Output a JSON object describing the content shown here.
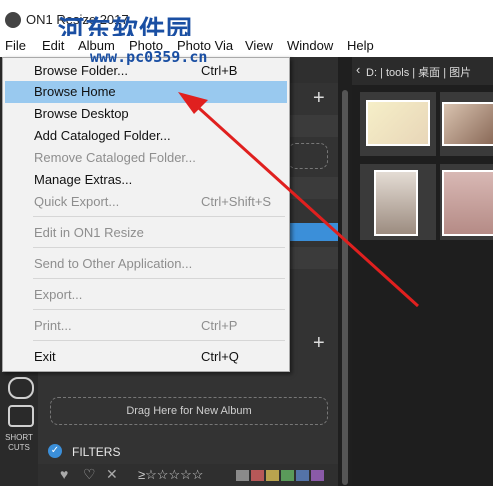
{
  "window": {
    "title": "ON1 Resize 2017"
  },
  "watermark": {
    "text": "河东软件园",
    "url": "www.pc0359.cn"
  },
  "menubar": {
    "items": [
      {
        "label": "File"
      },
      {
        "label": "Edit"
      },
      {
        "label": "Album"
      },
      {
        "label": "Photo"
      },
      {
        "label": "Photo Via"
      },
      {
        "label": "View"
      },
      {
        "label": "Window"
      },
      {
        "label": "Help"
      }
    ]
  },
  "file_menu": {
    "items": [
      {
        "label": "Browse Folder...",
        "shortcut": "Ctrl+B",
        "enabled": true
      },
      {
        "label": "Browse Home",
        "shortcut": "",
        "enabled": true,
        "highlighted": true
      },
      {
        "label": "Browse Desktop",
        "shortcut": "",
        "enabled": true
      },
      {
        "label": "Add Cataloged Folder...",
        "shortcut": "",
        "enabled": true
      },
      {
        "label": "Remove Cataloged Folder...",
        "shortcut": "",
        "enabled": false
      },
      {
        "label": "Manage Extras...",
        "shortcut": "",
        "enabled": true
      },
      {
        "label": "Quick Export...",
        "shortcut": "Ctrl+Shift+S",
        "enabled": false
      },
      {
        "label": "Edit in ON1 Resize",
        "shortcut": "",
        "enabled": false
      },
      {
        "label": "Send to Other Application...",
        "shortcut": "",
        "enabled": false
      },
      {
        "label": "Export...",
        "shortcut": "",
        "enabled": false
      },
      {
        "label": "Print...",
        "shortcut": "Ctrl+P",
        "enabled": false
      },
      {
        "label": "Exit",
        "shortcut": "Ctrl+Q",
        "enabled": true
      }
    ]
  },
  "path_bar": {
    "text": "D: | tools | 桌面 | 图片"
  },
  "albums": {
    "drag_label": "Drag Here for New Album"
  },
  "side_rail": {
    "shortcuts_label": "SHORT CUTS"
  },
  "filters": {
    "label": "FILTERS"
  },
  "colors": {
    "highlight": "#99c9ef",
    "accent": "#3b8fd9",
    "arrow": "#e0201f",
    "watermark": "#1a4fa3"
  }
}
